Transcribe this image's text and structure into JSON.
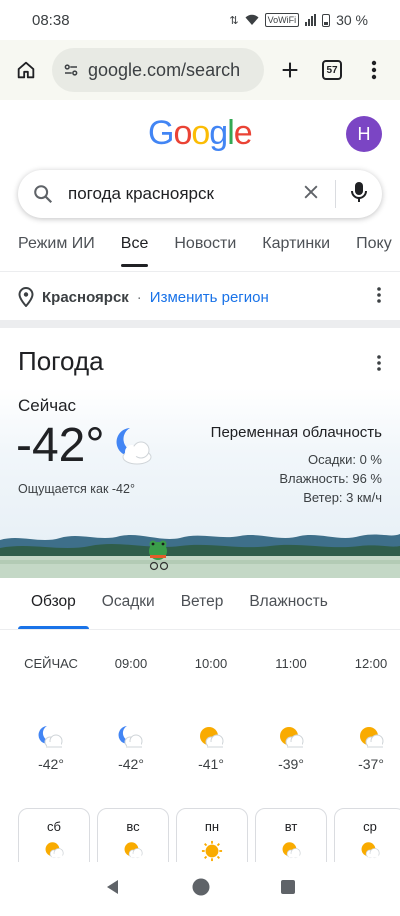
{
  "status_bar": {
    "time": "08:38",
    "network": "VoWiFi",
    "battery": "30 %"
  },
  "browser": {
    "url": "google.com/search",
    "tab_count": "57"
  },
  "google": {
    "avatar_letter": "Н",
    "logo_letters": [
      "G",
      "o",
      "o",
      "g",
      "l",
      "e"
    ]
  },
  "search": {
    "query": "погода красноярск"
  },
  "tabs": [
    {
      "label": "Режим ИИ"
    },
    {
      "label": "Все"
    },
    {
      "label": "Новости"
    },
    {
      "label": "Картинки"
    },
    {
      "label": "Поку"
    }
  ],
  "location": {
    "city": "Красноярск",
    "separator": "·",
    "change_label": "Изменить регион"
  },
  "weather": {
    "title": "Погода",
    "now_label": "Сейчас",
    "temperature": "-42°",
    "feels_like": "Ощущается как -42°",
    "condition": "Переменная облачность",
    "precipitation": "Осадки: 0 %",
    "humidity": "Влажность: 96 %",
    "wind": "Ветер: 3 км/ч",
    "tabs": [
      {
        "label": "Обзор"
      },
      {
        "label": "Осадки"
      },
      {
        "label": "Ветер"
      },
      {
        "label": "Влажность"
      }
    ],
    "hourly": [
      {
        "time": "СЕЙЧАС",
        "temp": "-42°",
        "icon": "moon-cloud-icon"
      },
      {
        "time": "09:00",
        "temp": "-42°",
        "icon": "moon-cloud-icon"
      },
      {
        "time": "10:00",
        "temp": "-41°",
        "icon": "sun-cloud-icon"
      },
      {
        "time": "11:00",
        "temp": "-39°",
        "icon": "sun-cloud-icon"
      },
      {
        "time": "12:00",
        "temp": "-37°",
        "icon": "sun-cloud-icon"
      }
    ],
    "daily": [
      {
        "day": "сб",
        "icon": "sun-cloud-icon"
      },
      {
        "day": "вс",
        "icon": "sun-cloud-icon"
      },
      {
        "day": "пн",
        "icon": "sun-icon"
      },
      {
        "day": "вт",
        "icon": "sun-cloud-icon"
      },
      {
        "day": "ср",
        "icon": "sun-cloud-icon"
      }
    ]
  },
  "colors": {
    "accent": "#1a73e8",
    "avatar": "#7b45c4",
    "sun": "#f9ab00",
    "moon": "#4285f4"
  }
}
